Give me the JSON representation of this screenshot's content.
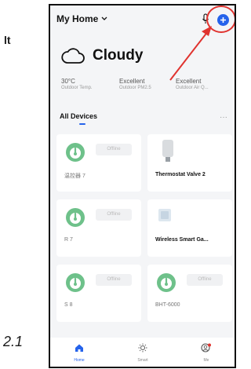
{
  "doc": {
    "side_letter": "lt",
    "page_number": "2.1"
  },
  "header": {
    "home_name": "My Home"
  },
  "weather": {
    "condition": "Cloudy",
    "stats": [
      {
        "value": "30°C",
        "label": "Outdoor Temp."
      },
      {
        "value": "Excellent",
        "label": "Outdoor PM2.5"
      },
      {
        "value": "Excellent",
        "label": "Outdoor Air Q..."
      }
    ]
  },
  "devices": {
    "section_title": "All Devices",
    "more_label": "···",
    "offline_label": "Offline",
    "items": [
      {
        "name": "温控器 7",
        "status": "offline"
      },
      {
        "name": "Thermostat Valve 2",
        "status": "online"
      },
      {
        "name": "R 7",
        "status": "offline"
      },
      {
        "name": "Wireless Smart Ga...",
        "status": "online"
      },
      {
        "name": "S 8",
        "status": "offline"
      },
      {
        "name": "BHT-6000",
        "status": "offline"
      }
    ]
  },
  "tabs": [
    {
      "label": "Home",
      "icon": "home-icon",
      "active": true
    },
    {
      "label": "Smart",
      "icon": "sun-icon",
      "active": false
    },
    {
      "label": "Me",
      "icon": "user-icon",
      "active": false
    }
  ],
  "colors": {
    "accent": "#2563eb",
    "annotation": "#e0332f",
    "thermostat_green": "#6ec18a",
    "background": "#f4f5f7"
  }
}
